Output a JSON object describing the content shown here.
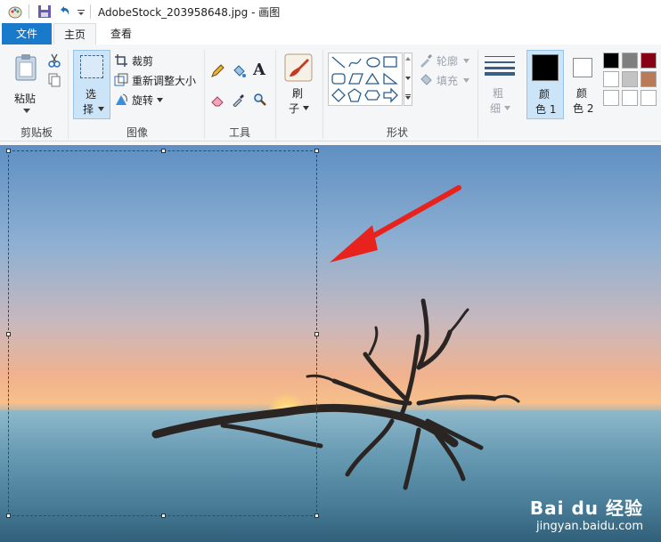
{
  "window": {
    "title": "AdobeStock_203958648.jpg - 画图"
  },
  "tabs": [
    {
      "label": "文件"
    },
    {
      "label": "主页"
    },
    {
      "label": "查看"
    }
  ],
  "ribbon": {
    "clipboard": {
      "paste_label": "粘贴",
      "group_label": "剪贴板"
    },
    "image": {
      "select_label_line1": "选",
      "select_label_line2": "择",
      "crop_label": "裁剪",
      "resize_label": "重新调整大小",
      "rotate_label": "旋转",
      "group_label": "图像"
    },
    "tools": {
      "group_label": "工具",
      "text_tool_glyph": "A"
    },
    "brushes": {
      "label_line1": "刷",
      "label_line2": "子"
    },
    "shapes": {
      "outline_label": "轮廓",
      "fill_label": "填充",
      "group_label": "形状"
    },
    "size": {
      "label_line1": "粗",
      "label_line2": "细"
    },
    "color1": {
      "label_line1": "颜",
      "label_line2": "色 1"
    },
    "color2": {
      "label_line1": "颜",
      "label_line2": "色 2"
    },
    "palette": [
      "#000000",
      "#7f7f7f",
      "#880015",
      "#ffffff",
      "#c3c3c3",
      "#b97a57",
      "#ffffff",
      "#ffffff",
      "#ffffff"
    ]
  },
  "canvas": {
    "watermark_brand": "Bai du 经验",
    "watermark_url": "jingyan.baidu.com"
  },
  "colors": {
    "file_tab": "#1979ca",
    "arrow": "#e8231e",
    "selection_bg": "#cce4f7"
  }
}
